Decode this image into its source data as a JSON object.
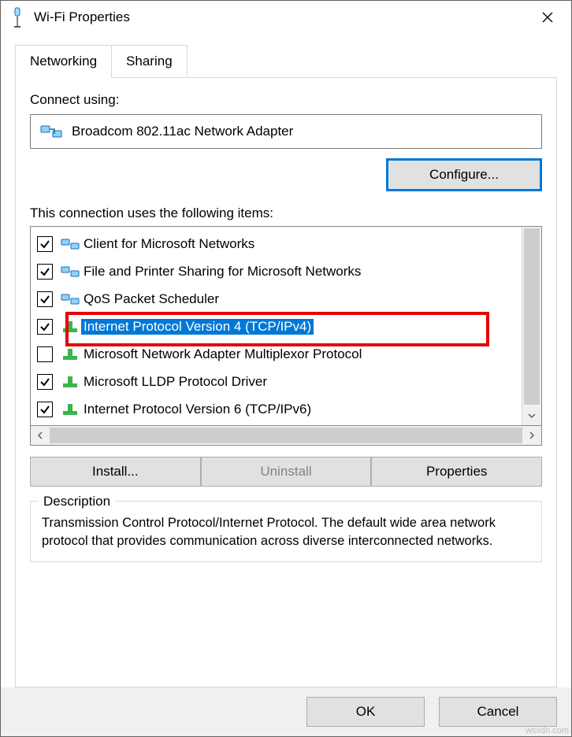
{
  "window": {
    "title": "Wi-Fi Properties"
  },
  "tabs": {
    "networking": "Networking",
    "sharing": "Sharing"
  },
  "connect_using_label": "Connect using:",
  "adapter_name": "Broadcom 802.11ac Network Adapter",
  "configure_btn": "Configure...",
  "items_label": "This connection uses the following items:",
  "items": [
    {
      "checked": true,
      "label": "Client for Microsoft Networks",
      "icon": "client",
      "selected": false
    },
    {
      "checked": true,
      "label": "File and Printer Sharing for Microsoft Networks",
      "icon": "client",
      "selected": false
    },
    {
      "checked": true,
      "label": "QoS Packet Scheduler",
      "icon": "client",
      "selected": false
    },
    {
      "checked": true,
      "label": "Internet Protocol Version 4 (TCP/IPv4)",
      "icon": "proto",
      "selected": true
    },
    {
      "checked": false,
      "label": "Microsoft Network Adapter Multiplexor Protocol",
      "icon": "proto",
      "selected": false
    },
    {
      "checked": true,
      "label": "Microsoft LLDP Protocol Driver",
      "icon": "proto",
      "selected": false
    },
    {
      "checked": true,
      "label": "Internet Protocol Version 6 (TCP/IPv6)",
      "icon": "proto",
      "selected": false
    }
  ],
  "buttons": {
    "install": "Install...",
    "uninstall": "Uninstall",
    "properties": "Properties"
  },
  "description": {
    "heading": "Description",
    "text": "Transmission Control Protocol/Internet Protocol. The default wide area network protocol that provides communication across diverse interconnected networks."
  },
  "footer": {
    "ok": "OK",
    "cancel": "Cancel"
  },
  "watermark": "wsxdn.com"
}
